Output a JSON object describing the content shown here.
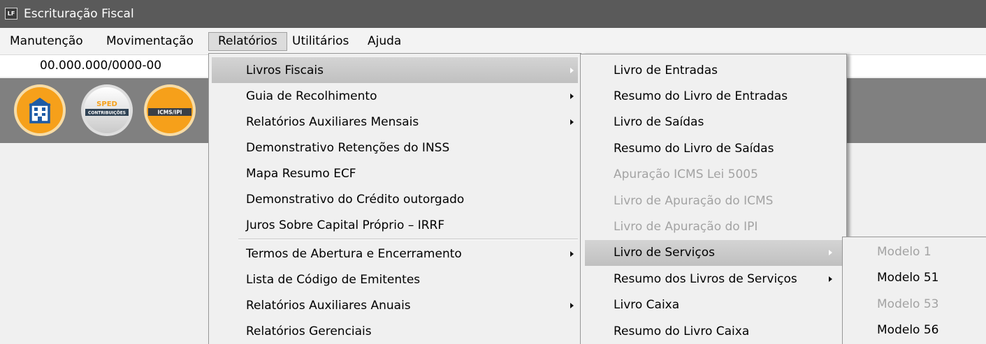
{
  "window": {
    "title": "Escrituração Fiscal",
    "icon_text": "LF"
  },
  "menubar": {
    "items": [
      {
        "label": "Manutenção"
      },
      {
        "label": "Movimentação"
      },
      {
        "label": "Relatórios",
        "active": true
      },
      {
        "label": "Utilitários"
      },
      {
        "label": "Ajuda"
      }
    ]
  },
  "company": {
    "cnpj": "00.000.000/0000-00"
  },
  "toolbar": {
    "buttons": [
      {
        "icon": "building-icon"
      },
      {
        "icon": "sped-contribuicoes-icon",
        "title": "SPED",
        "band": "CONTRIBUIÇÕES"
      },
      {
        "icon": "icms-ipi-icon",
        "band": "ICMS/IPI"
      }
    ]
  },
  "menus": {
    "relatorios": {
      "items": [
        {
          "label": "Livros Fiscais",
          "submenu": true,
          "highlighted": true
        },
        {
          "label": "Guia de Recolhimento",
          "submenu": true
        },
        {
          "label": "Relatórios Auxiliares Mensais",
          "submenu": true
        },
        {
          "label": "Demonstrativo Retenções do INSS"
        },
        {
          "label": "Mapa Resumo ECF"
        },
        {
          "label": "Demonstrativo do Crédito outorgado"
        },
        {
          "label": "Juros Sobre Capital Próprio – IRRF"
        },
        {
          "label": "Termos de Abertura e Encerramento",
          "submenu": true
        },
        {
          "label": "Lista de Código de Emitentes"
        },
        {
          "label": "Relatórios Auxiliares Anuais",
          "submenu": true
        },
        {
          "label": "Relatórios Gerenciais"
        }
      ]
    },
    "livros_fiscais": {
      "items": [
        {
          "label": "Livro de Entradas"
        },
        {
          "label": "Resumo do Livro de Entradas"
        },
        {
          "label": "Livro de Saídas"
        },
        {
          "label": "Resumo do Livro de Saídas"
        },
        {
          "label": "Apuração ICMS Lei 5005",
          "enabled": false
        },
        {
          "label": "Livro de Apuração do ICMS",
          "enabled": false
        },
        {
          "label": "Livro de Apuração do IPI",
          "enabled": false
        },
        {
          "label": "Livro de Serviços",
          "submenu": true,
          "highlighted": true
        },
        {
          "label": "Resumo dos Livros de Serviços",
          "submenu": true
        },
        {
          "label": "Livro Caixa"
        },
        {
          "label": "Resumo do Livro Caixa"
        }
      ]
    },
    "livro_de_servicos": {
      "items": [
        {
          "label": "Modelo 1",
          "enabled": false
        },
        {
          "label": "Modelo 51"
        },
        {
          "label": "Modelo 53",
          "enabled": false
        },
        {
          "label": "Modelo 56"
        }
      ]
    }
  },
  "colors": {
    "titlebar": "#5a5a5a",
    "toolbar_band": "#808080",
    "menu_background": "#f0f0f0",
    "highlight": "#c0c0c0",
    "disabled_text": "#a3a3a3",
    "icon_orange": "#f6a01a",
    "icon_blue": "#1d5ba6"
  }
}
